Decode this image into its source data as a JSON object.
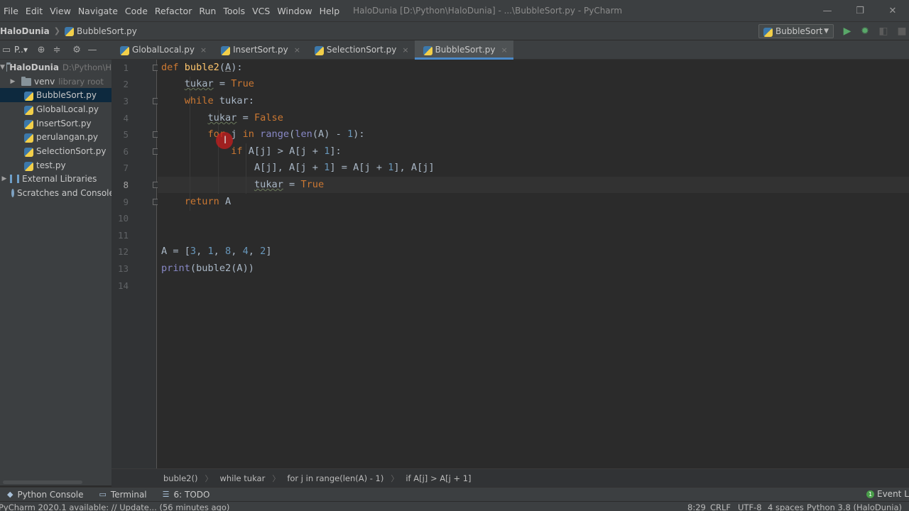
{
  "menu": [
    "File",
    "Edit",
    "View",
    "Navigate",
    "Code",
    "Refactor",
    "Run",
    "Tools",
    "VCS",
    "Window",
    "Help"
  ],
  "window_title": "HaloDunia [D:\\Python\\HaloDunia] - ...\\BubbleSort.py - PyCharm",
  "window_controls": {
    "minimize": "—",
    "restore": "❐",
    "close": "✕"
  },
  "navbar": {
    "project": "HaloDunia",
    "file": "BubbleSort.py"
  },
  "run_config": "BubbleSort",
  "project_toolbar": {
    "title": "P..▾"
  },
  "tabs": [
    {
      "label": "GlobalLocal.py",
      "close": "×"
    },
    {
      "label": "InsertSort.py",
      "close": "×"
    },
    {
      "label": "SelectionSort.py",
      "close": "×"
    },
    {
      "label": "BubbleSort.py",
      "close": "×",
      "active": true
    }
  ],
  "tree": {
    "root_name": "HaloDunia",
    "root_path": "D:\\Python\\H",
    "venv": "venv",
    "venv_note": "library root",
    "files": [
      "BubbleSort.py",
      "GlobalLocal.py",
      "InsertSort.py",
      "perulangan.py",
      "SelectionSort.py",
      "test.py"
    ],
    "external_libraries": "External Libraries",
    "scratches": "Scratches and Consoles"
  },
  "line_numbers": [
    "1",
    "2",
    "3",
    "4",
    "5",
    "6",
    "7",
    "8",
    "9",
    "10",
    "11",
    "12",
    "13",
    "14"
  ],
  "current_line": 8,
  "breadcrumbs": [
    "buble2()",
    "while tukar",
    "for j in range(len(A) - 1)",
    "if A[j] > A[j + 1]"
  ],
  "tool_windows": [
    {
      "label": "Python Console",
      "icon": "python-console-icon"
    },
    {
      "label": "Terminal",
      "icon": "terminal-icon"
    },
    {
      "label": "6: TODO",
      "icon": "todo-icon"
    }
  ],
  "event_log": "Event Log",
  "event_log_badge": "1",
  "status": {
    "message": "PyCharm 2020.1 available: // Update... (56 minutes ago)",
    "caret_position": "8:29",
    "line_separator": "CRLF",
    "encoding": "UTF-8",
    "indent": "4 spaces",
    "interpreter": "Python 3.8 (HaloDunia)"
  },
  "colors": {
    "keyword": "#cc7832",
    "function": "#ffc66d",
    "number": "#6897bb",
    "builtin": "#8888c6",
    "default": "#a9b7c6",
    "selection": "#0d293e",
    "tab_underline": "#4a88c7"
  }
}
